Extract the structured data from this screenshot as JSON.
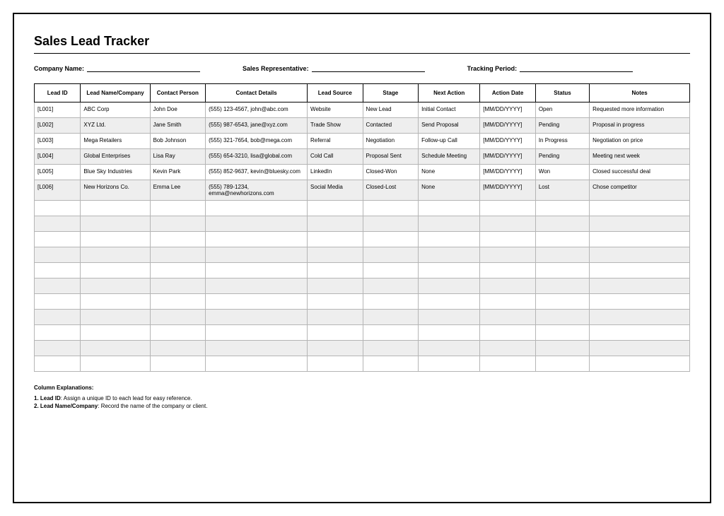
{
  "title": "Sales Lead Tracker",
  "meta": {
    "company_label": "Company Name:",
    "rep_label": "Sales Representative:",
    "period_label": "Tracking Period:"
  },
  "columns": [
    "Lead ID",
    "Lead Name/Company",
    "Contact Person",
    "Contact Details",
    "Lead Source",
    "Stage",
    "Next Action",
    "Action Date",
    "Status",
    "Notes"
  ],
  "rows": [
    {
      "id": "[L001]",
      "name": "ABC Corp",
      "person": "John Doe",
      "contact": "(555) 123-4567, john@abc.com",
      "source": "Website",
      "stage": "New Lead",
      "action": "Initial Contact",
      "date": "[MM/DD/YYYY]",
      "status": "Open",
      "notes": "Requested more information"
    },
    {
      "id": "[L002]",
      "name": "XYZ Ltd.",
      "person": "Jane Smith",
      "contact": "(555) 987-6543, jane@xyz.com",
      "source": "Trade Show",
      "stage": "Contacted",
      "action": "Send Proposal",
      "date": "[MM/DD/YYYY]",
      "status": "Pending",
      "notes": "Proposal in progress"
    },
    {
      "id": "[L003]",
      "name": "Mega Retailers",
      "person": "Bob Johnson",
      "contact": "(555) 321-7654, bob@mega.com",
      "source": "Referral",
      "stage": "Negotiation",
      "action": "Follow-up Call",
      "date": "[MM/DD/YYYY]",
      "status": "In Progress",
      "notes": "Negotiation on price"
    },
    {
      "id": "[L004]",
      "name": "Global Enterprises",
      "person": "Lisa Ray",
      "contact": "(555) 654-3210, lisa@global.com",
      "source": "Cold Call",
      "stage": "Proposal Sent",
      "action": "Schedule Meeting",
      "date": "[MM/DD/YYYY]",
      "status": "Pending",
      "notes": "Meeting next week"
    },
    {
      "id": "[L005]",
      "name": "Blue Sky Industries",
      "person": "Kevin Park",
      "contact": "(555) 852-9637, kevin@bluesky.com",
      "source": "LinkedIn",
      "stage": "Closed-Won",
      "action": "None",
      "date": "[MM/DD/YYYY]",
      "status": "Won",
      "notes": "Closed successful deal"
    },
    {
      "id": "[L006]",
      "name": "New Horizons Co.",
      "person": "Emma Lee",
      "contact": "(555) 789-1234, emma@newhorizons.com",
      "source": "Social Media",
      "stage": "Closed-Lost",
      "action": "None",
      "date": "[MM/DD/YYYY]",
      "status": "Lost",
      "notes": "Chose competitor"
    }
  ],
  "blank_row_count": 11,
  "explain": {
    "heading": "Column Explanations:",
    "items": [
      {
        "num": "1.",
        "term": "Lead ID",
        "desc": ": Assign a unique ID to each lead for easy reference."
      },
      {
        "num": "2.",
        "term": "Lead Name/Company",
        "desc": ": Record the name of the company or client."
      }
    ]
  }
}
